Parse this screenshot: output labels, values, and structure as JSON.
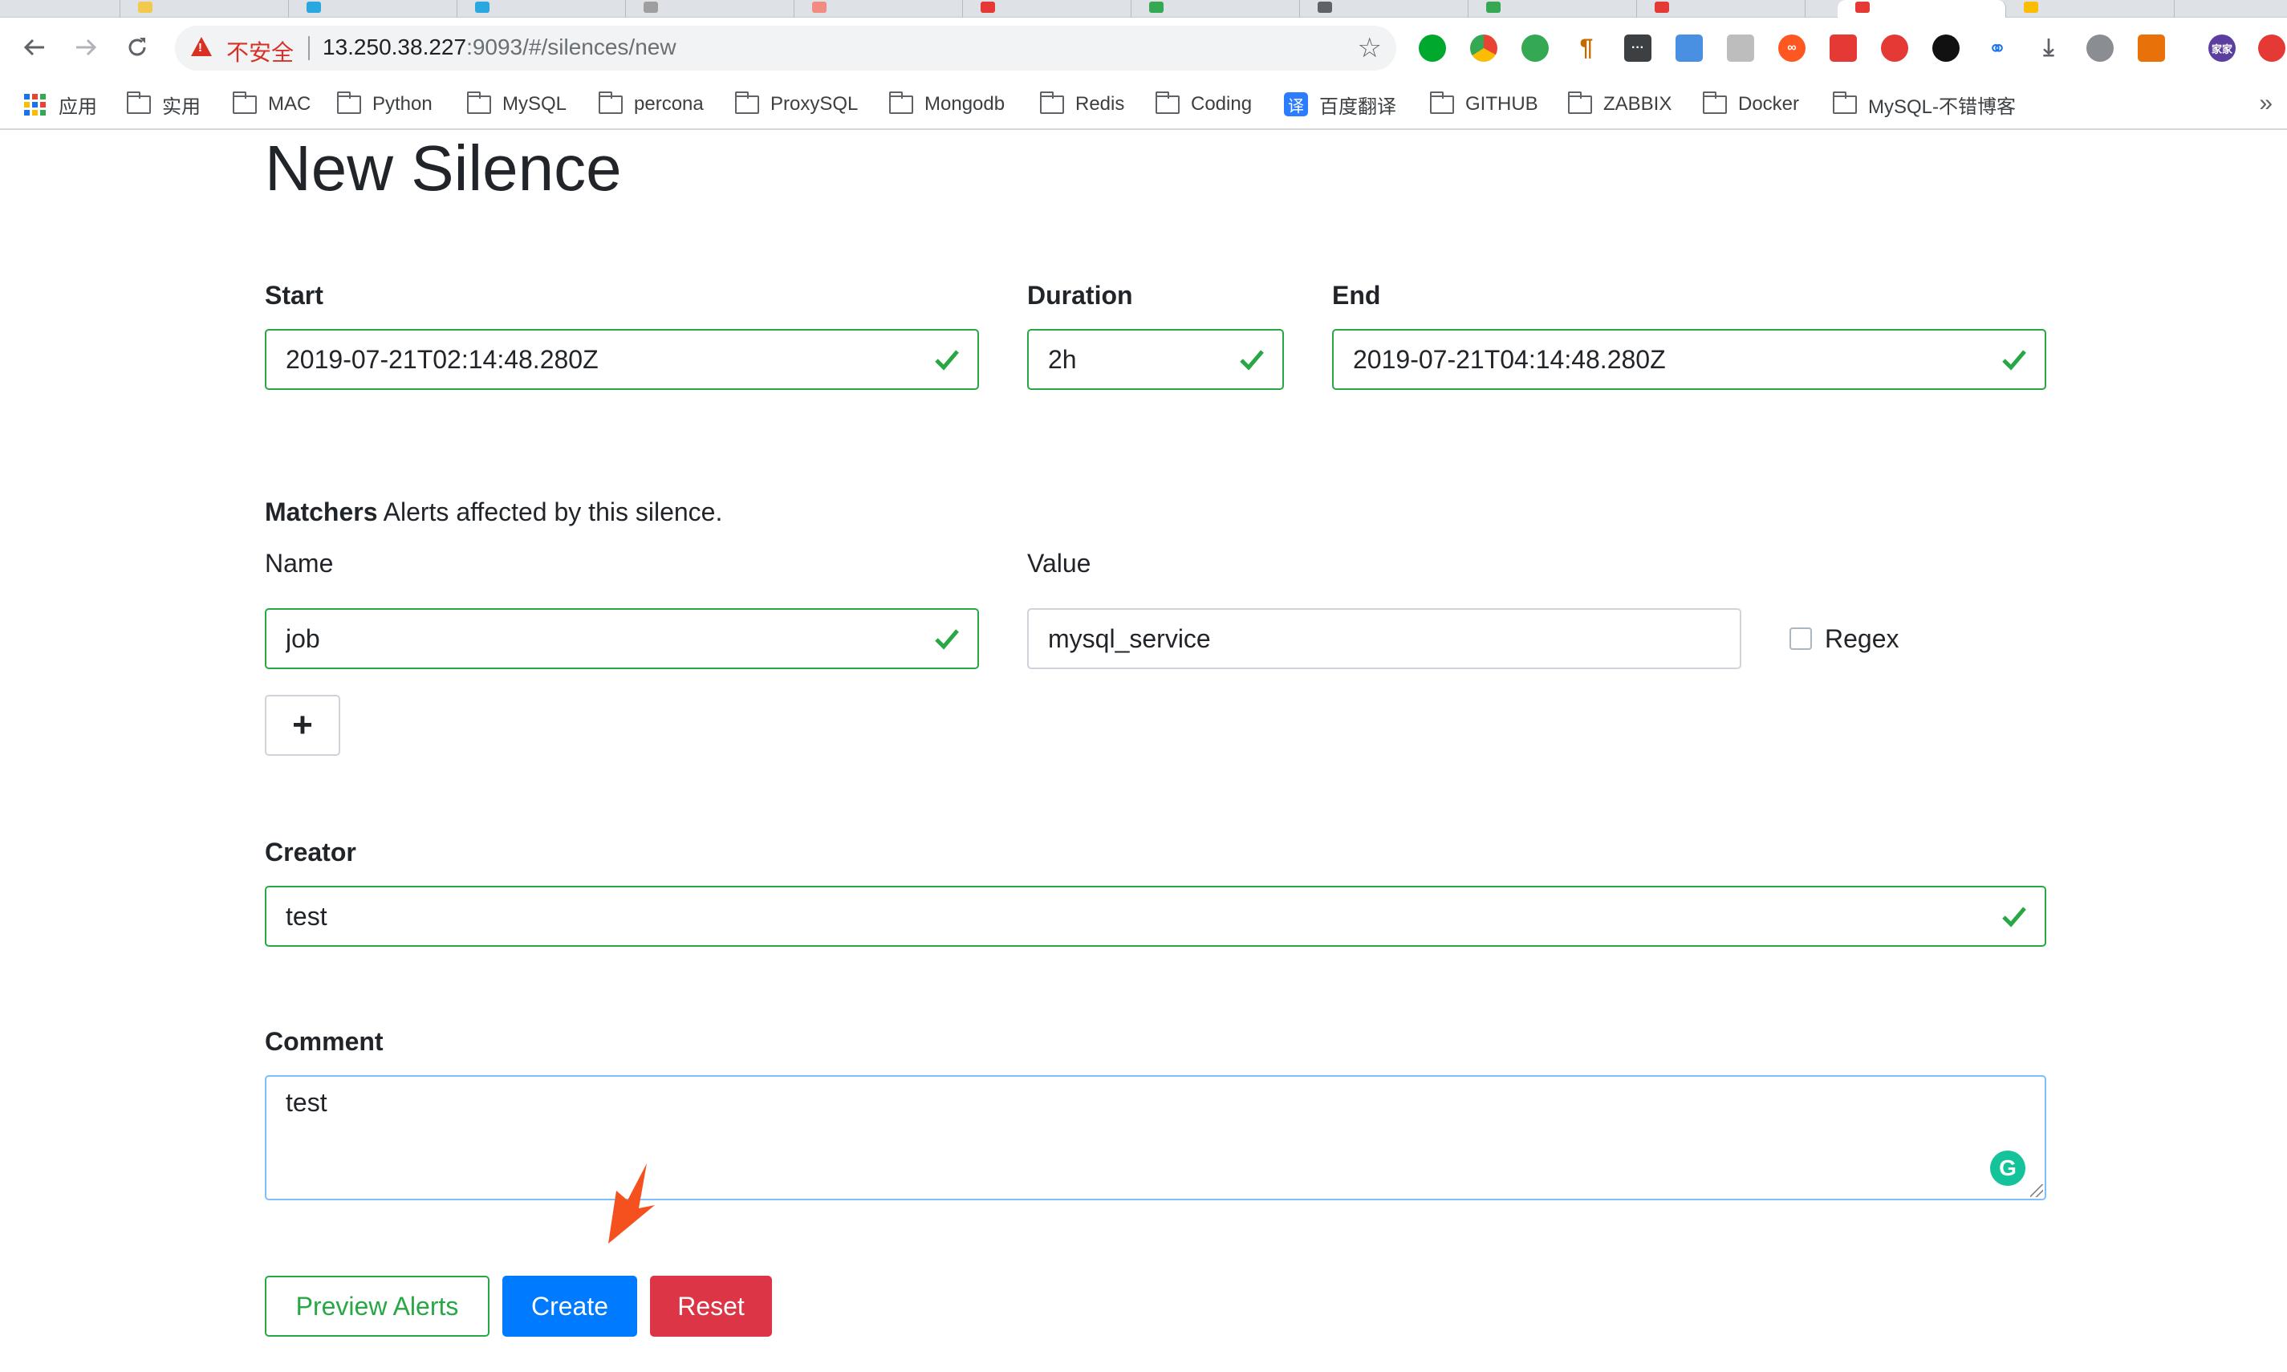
{
  "browser": {
    "address": {
      "security_label": "不安全",
      "host": "13.250.38.227",
      "path": ":9093/#/silences/new"
    },
    "bookmarks": [
      {
        "label": "应用",
        "icon": "apps-icon"
      },
      {
        "label": "实用",
        "icon": "folder-icon"
      },
      {
        "label": "MAC",
        "icon": "folder-icon"
      },
      {
        "label": "Python",
        "icon": "folder-icon"
      },
      {
        "label": "MySQL",
        "icon": "folder-icon"
      },
      {
        "label": "percona",
        "icon": "folder-icon"
      },
      {
        "label": "ProxySQL",
        "icon": "folder-icon"
      },
      {
        "label": "Mongodb",
        "icon": "folder-icon"
      },
      {
        "label": "Redis",
        "icon": "folder-icon"
      },
      {
        "label": "Coding",
        "icon": "folder-icon"
      },
      {
        "label": "百度翻译",
        "icon": "translate-icon"
      },
      {
        "label": "GITHUB",
        "icon": "folder-icon"
      },
      {
        "label": "ZABBIX",
        "icon": "folder-icon"
      },
      {
        "label": "Docker",
        "icon": "folder-icon"
      },
      {
        "label": "MySQL-不错博客",
        "icon": "folder-icon"
      }
    ],
    "more_label": "»",
    "profile_label": "家家"
  },
  "page": {
    "title": "New Silence",
    "start": {
      "label": "Start",
      "value": "2019-07-21T02:14:48.280Z"
    },
    "duration": {
      "label": "Duration",
      "value": "2h"
    },
    "end": {
      "label": "End",
      "value": "2019-07-21T04:14:48.280Z"
    },
    "matchers": {
      "heading": "Matchers",
      "description": "Alerts affected by this silence.",
      "name_label": "Name",
      "value_label": "Value",
      "name_value": "job",
      "value_value": "mysql_service",
      "regex_label": "Regex",
      "add_label": "+"
    },
    "creator": {
      "label": "Creator",
      "value": "test"
    },
    "comment": {
      "label": "Comment",
      "value": "test"
    },
    "buttons": {
      "preview": "Preview Alerts",
      "create": "Create",
      "reset": "Reset"
    }
  },
  "colors": {
    "valid": "#28a745",
    "primary": "#007bff",
    "danger": "#dc3545",
    "annotation_arrow": "#f4511e"
  }
}
